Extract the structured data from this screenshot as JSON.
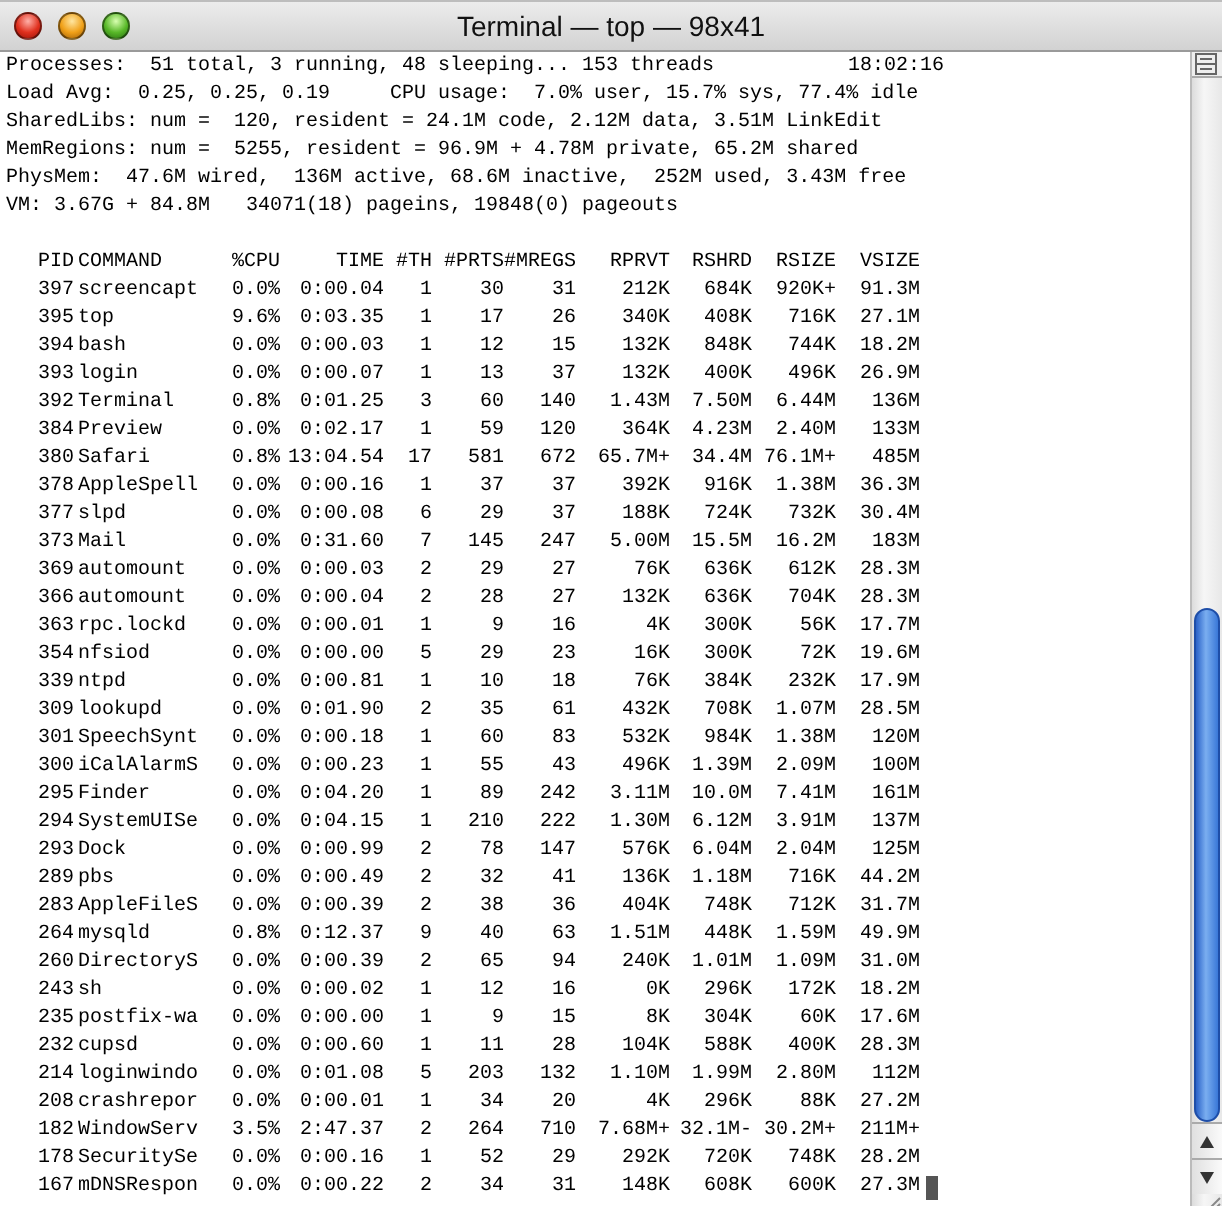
{
  "window": {
    "title": "Terminal — top — 98x41"
  },
  "summary": {
    "clock": "18:02:16",
    "lines": [
      "Processes:  51 total, 3 running, 48 sleeping... 153 threads",
      "Load Avg:  0.25, 0.25, 0.19     CPU usage:  7.0% user, 15.7% sys, 77.4% idle",
      "SharedLibs: num =  120, resident = 24.1M code, 2.12M data, 3.51M LinkEdit",
      "MemRegions: num =  5255, resident = 96.9M + 4.78M private, 65.2M shared",
      "PhysMem:  47.6M wired,  136M active, 68.6M inactive,  252M used, 3.43M free",
      "VM: 3.67G + 84.8M   34071(18) pageins, 19848(0) pageouts"
    ]
  },
  "table": {
    "columns": [
      "PID",
      "COMMAND",
      "%CPU",
      "TIME",
      "#TH",
      "#PRTS",
      "#MREGS",
      "RPRVT",
      "RSHRD",
      "RSIZE",
      "VSIZE"
    ],
    "rows": [
      [
        "397",
        "screencapt",
        "0.0%",
        "0:00.04",
        "1",
        "30",
        "31",
        "212K",
        "684K",
        "920K+",
        "91.3M"
      ],
      [
        "395",
        "top",
        "9.6%",
        "0:03.35",
        "1",
        "17",
        "26",
        "340K",
        "408K",
        "716K",
        "27.1M"
      ],
      [
        "394",
        "bash",
        "0.0%",
        "0:00.03",
        "1",
        "12",
        "15",
        "132K",
        "848K",
        "744K",
        "18.2M"
      ],
      [
        "393",
        "login",
        "0.0%",
        "0:00.07",
        "1",
        "13",
        "37",
        "132K",
        "400K",
        "496K",
        "26.9M"
      ],
      [
        "392",
        "Terminal",
        "0.8%",
        "0:01.25",
        "3",
        "60",
        "140",
        "1.43M",
        "7.50M",
        "6.44M",
        "136M"
      ],
      [
        "384",
        "Preview",
        "0.0%",
        "0:02.17",
        "1",
        "59",
        "120",
        "364K",
        "4.23M",
        "2.40M",
        "133M"
      ],
      [
        "380",
        "Safari",
        "0.8%",
        "13:04.54",
        "17",
        "581",
        "672",
        "65.7M+",
        "34.4M",
        "76.1M+",
        "485M"
      ],
      [
        "378",
        "AppleSpell",
        "0.0%",
        "0:00.16",
        "1",
        "37",
        "37",
        "392K",
        "916K",
        "1.38M",
        "36.3M"
      ],
      [
        "377",
        "slpd",
        "0.0%",
        "0:00.08",
        "6",
        "29",
        "37",
        "188K",
        "724K",
        "732K",
        "30.4M"
      ],
      [
        "373",
        "Mail",
        "0.0%",
        "0:31.60",
        "7",
        "145",
        "247",
        "5.00M",
        "15.5M",
        "16.2M",
        "183M"
      ],
      [
        "369",
        "automount",
        "0.0%",
        "0:00.03",
        "2",
        "29",
        "27",
        "76K",
        "636K",
        "612K",
        "28.3M"
      ],
      [
        "366",
        "automount",
        "0.0%",
        "0:00.04",
        "2",
        "28",
        "27",
        "132K",
        "636K",
        "704K",
        "28.3M"
      ],
      [
        "363",
        "rpc.lockd",
        "0.0%",
        "0:00.01",
        "1",
        "9",
        "16",
        "4K",
        "300K",
        "56K",
        "17.7M"
      ],
      [
        "354",
        "nfsiod",
        "0.0%",
        "0:00.00",
        "5",
        "29",
        "23",
        "16K",
        "300K",
        "72K",
        "19.6M"
      ],
      [
        "339",
        "ntpd",
        "0.0%",
        "0:00.81",
        "1",
        "10",
        "18",
        "76K",
        "384K",
        "232K",
        "17.9M"
      ],
      [
        "309",
        "lookupd",
        "0.0%",
        "0:01.90",
        "2",
        "35",
        "61",
        "432K",
        "708K",
        "1.07M",
        "28.5M"
      ],
      [
        "301",
        "SpeechSynt",
        "0.0%",
        "0:00.18",
        "1",
        "60",
        "83",
        "532K",
        "984K",
        "1.38M",
        "120M"
      ],
      [
        "300",
        "iCalAlarmS",
        "0.0%",
        "0:00.23",
        "1",
        "55",
        "43",
        "496K",
        "1.39M",
        "2.09M",
        "100M"
      ],
      [
        "295",
        "Finder",
        "0.0%",
        "0:04.20",
        "1",
        "89",
        "242",
        "3.11M",
        "10.0M",
        "7.41M",
        "161M"
      ],
      [
        "294",
        "SystemUISe",
        "0.0%",
        "0:04.15",
        "1",
        "210",
        "222",
        "1.30M",
        "6.12M",
        "3.91M",
        "137M"
      ],
      [
        "293",
        "Dock",
        "0.0%",
        "0:00.99",
        "2",
        "78",
        "147",
        "576K",
        "6.04M",
        "2.04M",
        "125M"
      ],
      [
        "289",
        "pbs",
        "0.0%",
        "0:00.49",
        "2",
        "32",
        "41",
        "136K",
        "1.18M",
        "716K",
        "44.2M"
      ],
      [
        "283",
        "AppleFileS",
        "0.0%",
        "0:00.39",
        "2",
        "38",
        "36",
        "404K",
        "748K",
        "712K",
        "31.7M"
      ],
      [
        "264",
        "mysqld",
        "0.8%",
        "0:12.37",
        "9",
        "40",
        "63",
        "1.51M",
        "448K",
        "1.59M",
        "49.9M"
      ],
      [
        "260",
        "DirectoryS",
        "0.0%",
        "0:00.39",
        "2",
        "65",
        "94",
        "240K",
        "1.01M",
        "1.09M",
        "31.0M"
      ],
      [
        "243",
        "sh",
        "0.0%",
        "0:00.02",
        "1",
        "12",
        "16",
        "0K",
        "296K",
        "172K",
        "18.2M"
      ],
      [
        "235",
        "postfix-wa",
        "0.0%",
        "0:00.00",
        "1",
        "9",
        "15",
        "8K",
        "304K",
        "60K",
        "17.6M"
      ],
      [
        "232",
        "cupsd",
        "0.0%",
        "0:00.60",
        "1",
        "11",
        "28",
        "104K",
        "588K",
        "400K",
        "28.3M"
      ],
      [
        "214",
        "loginwindo",
        "0.0%",
        "0:01.08",
        "5",
        "203",
        "132",
        "1.10M",
        "1.99M",
        "2.80M",
        "112M"
      ],
      [
        "208",
        "crashrepor",
        "0.0%",
        "0:00.01",
        "1",
        "34",
        "20",
        "4K",
        "296K",
        "88K",
        "27.2M"
      ],
      [
        "182",
        "WindowServ",
        "3.5%",
        "2:47.37",
        "2",
        "264",
        "710",
        "7.68M+",
        "32.1M-",
        "30.2M+",
        "211M+"
      ],
      [
        "178",
        "SecuritySe",
        "0.0%",
        "0:00.16",
        "1",
        "52",
        "29",
        "292K",
        "720K",
        "748K",
        "28.2M"
      ],
      [
        "167",
        "mDNSRespon",
        "0.0%",
        "0:00.22",
        "2",
        "34",
        "31",
        "148K",
        "608K",
        "600K",
        "27.3M"
      ]
    ],
    "cursor_visible": true
  }
}
